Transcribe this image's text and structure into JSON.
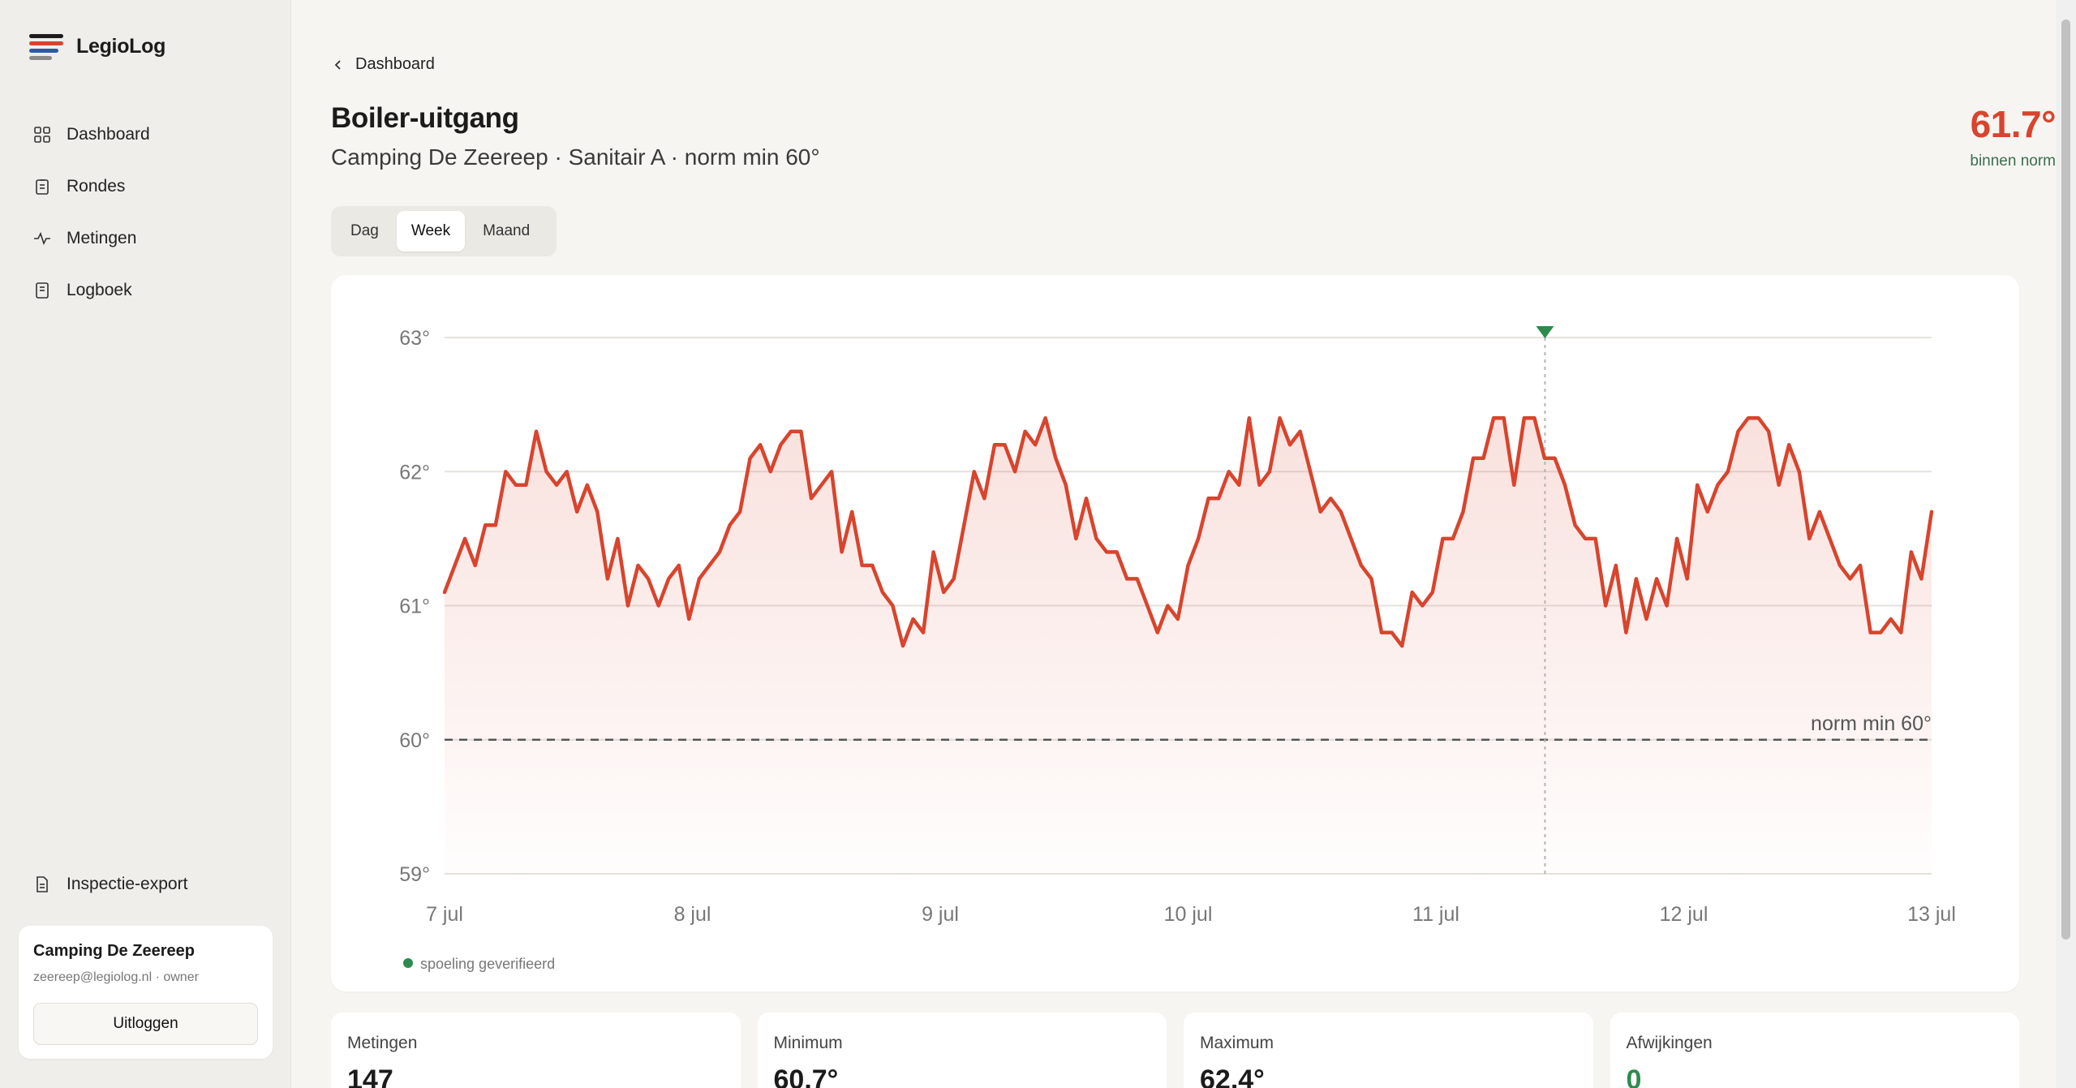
{
  "app": {
    "name": "LegioLog"
  },
  "nav": {
    "items": [
      {
        "label": "Dashboard",
        "icon": "grid-icon"
      },
      {
        "label": "Rondes",
        "icon": "clipboard-icon"
      },
      {
        "label": "Metingen",
        "icon": "activity-icon"
      },
      {
        "label": "Logboek",
        "icon": "book-icon"
      }
    ],
    "export_label": "Inspectie-export"
  },
  "account": {
    "name": "Camping De Zeereep",
    "email": "zeereep@legiolog.nl · owner",
    "logout_label": "Uitloggen"
  },
  "breadcrumb": {
    "back_label": "Dashboard"
  },
  "page": {
    "title": "Boiler-uitgang",
    "subtitle": "Camping De Zeereep · Sanitair A · norm min 60°",
    "current_temp": "61.7°",
    "status": "binnen norm"
  },
  "tabs": [
    {
      "label": "Dag",
      "active": false
    },
    {
      "label": "Week",
      "active": true
    },
    {
      "label": "Maand",
      "active": false
    }
  ],
  "chart_data": {
    "type": "area",
    "y_ticks": [
      "63°",
      "62°",
      "61°",
      "60°",
      "59°"
    ],
    "x_ticks": [
      "7 jul",
      "8 jul",
      "9 jul",
      "10 jul",
      "11 jul",
      "12 jul",
      "13 jul"
    ],
    "ylim": [
      59,
      63
    ],
    "xlim": [
      0,
      6
    ],
    "grid": true,
    "threshold": {
      "value": 60,
      "label": "norm min 60°"
    },
    "marker": {
      "x": 4.44,
      "label": "spoeling geverifieerd",
      "color": "#2e8b4d"
    },
    "series_color": "#d8442d",
    "values": [
      61.1,
      61.3,
      61.5,
      61.3,
      61.6,
      61.6,
      62.0,
      61.9,
      61.9,
      62.3,
      62.0,
      61.9,
      62.0,
      61.7,
      61.9,
      61.7,
      61.2,
      61.5,
      61.0,
      61.3,
      61.2,
      61.0,
      61.2,
      61.3,
      60.9,
      61.2,
      61.3,
      61.4,
      61.6,
      61.7,
      62.1,
      62.2,
      62.0,
      62.2,
      62.3,
      62.3,
      61.8,
      61.9,
      62.0,
      61.4,
      61.7,
      61.3,
      61.3,
      61.1,
      61.0,
      60.7,
      60.9,
      60.8,
      61.4,
      61.1,
      61.2,
      61.6,
      62.0,
      61.8,
      62.2,
      62.2,
      62.0,
      62.3,
      62.2,
      62.4,
      62.1,
      61.9,
      61.5,
      61.8,
      61.5,
      61.4,
      61.4,
      61.2,
      61.2,
      61.0,
      60.8,
      61.0,
      60.9,
      61.3,
      61.5,
      61.8,
      61.8,
      62.0,
      61.9,
      62.4,
      61.9,
      62.0,
      62.4,
      62.2,
      62.3,
      62.0,
      61.7,
      61.8,
      61.7,
      61.5,
      61.3,
      61.2,
      60.8,
      60.8,
      60.7,
      61.1,
      61.0,
      61.1,
      61.5,
      61.5,
      61.7,
      62.1,
      62.1,
      62.4,
      62.4,
      61.9,
      62.4,
      62.4,
      62.1,
      62.1,
      61.9,
      61.6,
      61.5,
      61.5,
      61.0,
      61.3,
      60.8,
      61.2,
      60.9,
      61.2,
      61.0,
      61.5,
      61.2,
      61.9,
      61.7,
      61.9,
      62.0,
      62.3,
      62.4,
      62.4,
      62.3,
      61.9,
      62.2,
      62.0,
      61.5,
      61.7,
      61.5,
      61.3,
      61.2,
      61.3,
      60.8,
      60.8,
      60.9,
      60.8,
      61.4,
      61.2,
      61.7
    ]
  },
  "stats": [
    {
      "label": "Metingen",
      "value": "147",
      "accent": false
    },
    {
      "label": "Minimum",
      "value": "60.7°",
      "accent": false
    },
    {
      "label": "Maximum",
      "value": "62.4°",
      "accent": false
    },
    {
      "label": "Afwijkingen",
      "value": "0",
      "accent": true
    }
  ],
  "colors": {
    "accent": "#d8442d",
    "ok": "#2e8b4d",
    "logo": [
      "#1b1b1b",
      "#d8442d",
      "#2b5aa8",
      "#8a8a8a"
    ]
  }
}
